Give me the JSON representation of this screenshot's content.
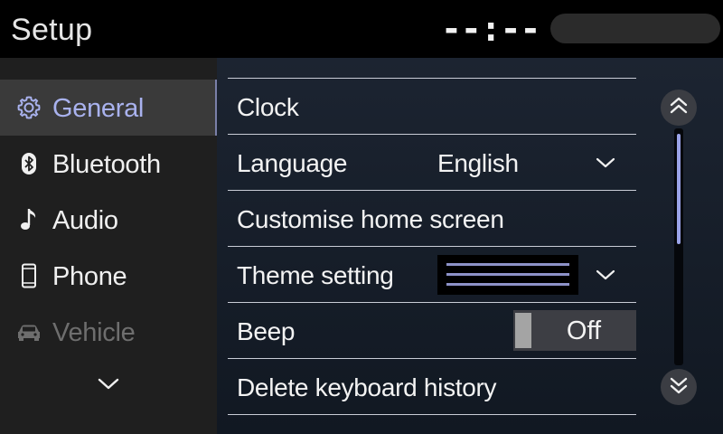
{
  "header": {
    "title": "Setup",
    "clock": "--:--"
  },
  "sidebar": {
    "items": [
      {
        "label": "General",
        "icon": "gear-icon",
        "active": true
      },
      {
        "label": "Bluetooth",
        "icon": "bluetooth-icon"
      },
      {
        "label": "Audio",
        "icon": "music-note-icon"
      },
      {
        "label": "Phone",
        "icon": "phone-icon"
      },
      {
        "label": "Vehicle",
        "icon": "car-icon",
        "disabled": true
      }
    ],
    "more_icon": "chevron-down-icon"
  },
  "settings": {
    "rows": [
      {
        "label": "Clock"
      },
      {
        "label": "Language",
        "value": "English"
      },
      {
        "label": "Customise home screen"
      },
      {
        "label": "Theme setting"
      },
      {
        "label": "Beep",
        "toggle": "Off"
      },
      {
        "label": "Delete keyboard history"
      }
    ]
  },
  "scroll": {
    "up_icon": "double-chevron-up-icon",
    "down_icon": "double-chevron-down-icon"
  },
  "colors": {
    "accent": "#a9b2ee",
    "sidebar_bg": "#1f1f1f",
    "active_item_bg": "#3a3a3a",
    "main_bg": "#1c2431"
  }
}
